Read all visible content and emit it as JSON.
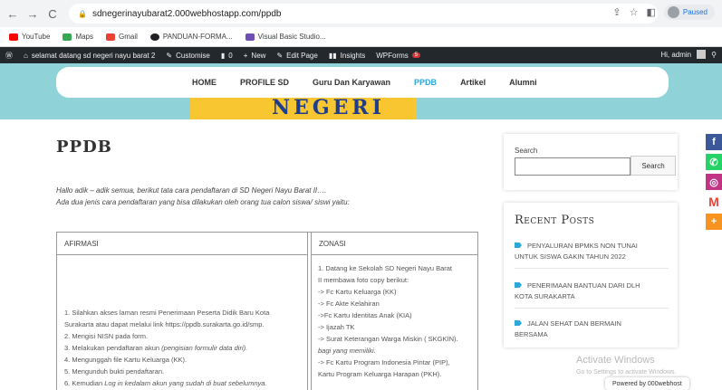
{
  "browser": {
    "back_icon": "back-arrow-icon",
    "forward_icon": "forward-arrow-icon",
    "reload_icon": "reload-icon",
    "url": "sdnegerinayubarat2.000webhostapp.com/ppdb",
    "paused_label": "Paused"
  },
  "bookmarks": [
    {
      "label": "YouTube",
      "color": "#ff0000"
    },
    {
      "label": "Maps",
      "color": "#34a853"
    },
    {
      "label": "Gmail",
      "color": "#ea4335"
    },
    {
      "label": "PANDUAN-FORMA...",
      "color": "#202124"
    },
    {
      "label": "Visual Basic Studio...",
      "color": "#6e4fb3"
    }
  ],
  "wp_admin": {
    "site_name": "selamat datang sd negeri nayu barat 2",
    "customise": "Customise",
    "comments": "0",
    "new": "New",
    "edit_page": "Edit Page",
    "insights": "Insights",
    "wpforms": "WPForms",
    "wpforms_badge": "5",
    "greeting": "Hi, admin"
  },
  "menu": [
    {
      "label": "HOME",
      "active": false
    },
    {
      "label": "PROFILE SD",
      "active": false
    },
    {
      "label": "Guru Dan Karyawan",
      "active": false
    },
    {
      "label": "PPDB",
      "active": true
    },
    {
      "label": "Artikel",
      "active": false
    },
    {
      "label": "Alumni",
      "active": false
    }
  ],
  "banner_text": "NEGERI",
  "page": {
    "title": "PPDB",
    "intro_line1": "Hallo adik – adik semua, berikut tata cara pendaftaran di SD Negeri Nayu Barat II….",
    "intro_line2": "Ada dua jenis cara pendaftaran yang bisa dilakukan oleh orang tua calon siswa/ siswi yaitu:"
  },
  "table": {
    "col1_header": "AFIRMASI",
    "col2_header": "ZONASI",
    "col1_lines": [
      {
        "text": "1. Silahkan akses laman resmi Penerimaan Peserta Didik Baru Kota",
        "em": ""
      },
      {
        "text": "Surakarta atau dapat melalui link https://ppdb.surakarta.go.id/smp.",
        "em": ""
      },
      {
        "text": "2. Mengisi NISN pada form.",
        "em": ""
      },
      {
        "text": "3. Melakukan pendaftaran akun ",
        "em": "(pengisian formulir data diri)."
      },
      {
        "text": "4. Mengunggah file Kartu Keluarga (KK).",
        "em": ""
      },
      {
        "text": "5. Mengunduh bukti pendaftaran.",
        "em": ""
      },
      {
        "text": "6. Kemudian ",
        "em": "Log in kedalam akun yang sudah di buat sebelumnya."
      }
    ],
    "col2_lines": [
      {
        "text": "1. Datang ke Sekolah SD Negeri Nayu Barat",
        "em": ""
      },
      {
        "text": "II membawa foto copy berikut:",
        "em": ""
      },
      {
        "text": "-> Fc Kartu Keluarga (KK)",
        "em": ""
      },
      {
        "text": "-> Fc Akte Kelahiran",
        "em": ""
      },
      {
        "text": "->Fc Kartu Identitas Anak (KIA)",
        "em": ""
      },
      {
        "text": "-> Ijazah TK",
        "em": ""
      },
      {
        "text": "-> Surat Keterangan Warga Miskin ( SKGKIN).",
        "em": ""
      },
      {
        "text": "",
        "em": "bagi yang memiliki."
      },
      {
        "text": "-> Fc Kartu Program Indonesia Pintar (PIP),",
        "em": ""
      },
      {
        "text": "Kartu Program Keluarga Harapan (PKH).",
        "em": ""
      }
    ]
  },
  "sidebar": {
    "search_label": "Search",
    "search_placeholder": "",
    "search_button": "Search",
    "recent_title": "Recent Posts",
    "posts": [
      {
        "line1": "PENYALURAN BPMKS NON TUNAI",
        "line2": "UNTUK SISWA GAKIN TAHUN 2022"
      },
      {
        "line1": "PENERIMAAN BANTUAN DARI DLH",
        "line2": "KOTA SURAKARTA"
      },
      {
        "line1": "JALAN SEHAT DAN BERMAIN",
        "line2": "BERSAMA"
      }
    ]
  },
  "social": [
    {
      "icon": "facebook-icon",
      "glyph": "f",
      "color": "#3b5998"
    },
    {
      "icon": "whatsapp-icon",
      "glyph": "✆",
      "color": "#25d366"
    },
    {
      "icon": "instagram-icon",
      "glyph": "◎",
      "color": "#c13584"
    },
    {
      "icon": "gmail-icon",
      "glyph": "M",
      "color": "#ffffff"
    },
    {
      "icon": "share-plus-icon",
      "glyph": "+",
      "color": "#f7931e"
    }
  ],
  "watermark": {
    "line1": "Activate Windows",
    "line2": "Go to Settings to activate Windows."
  },
  "powered_by": "Powered by 000webhost"
}
